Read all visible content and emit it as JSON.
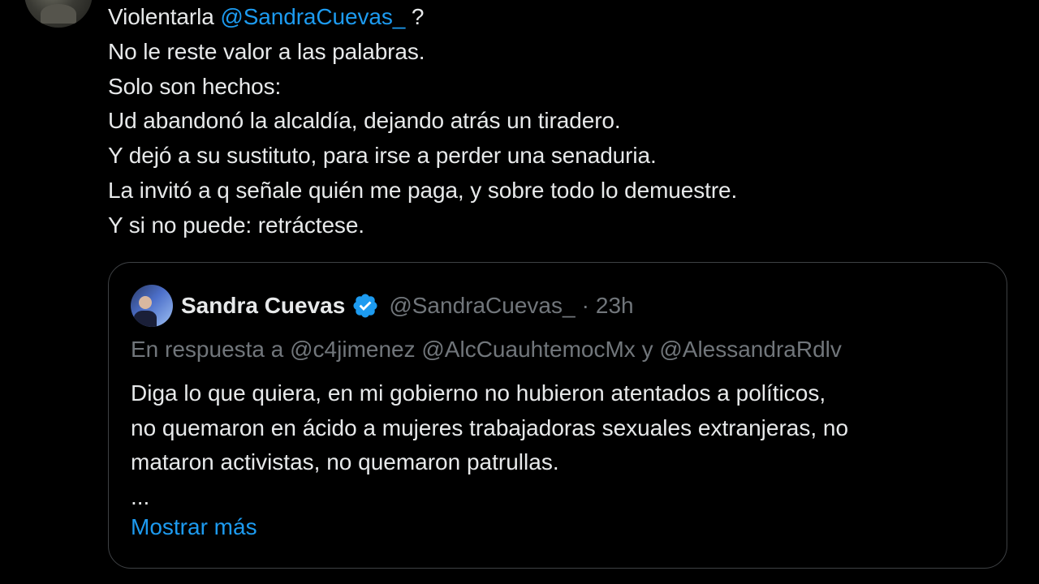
{
  "tweet": {
    "line1_prefix": "Violentarla ",
    "line1_mention": "@SandraCuevas_",
    "line1_suffix": " ?",
    "lines": [
      "No le reste valor a las palabras.",
      "Solo son hechos:",
      "Ud abandonó la alcaldía, dejando atrás un tiradero.",
      "Y dejó a su sustituto, para irse a perder una senaduria.",
      "La invitó a q señale quién me paga, y sobre todo lo demuestre.",
      "Y si no puede: retráctese."
    ]
  },
  "quote": {
    "name": "Sandra Cuevas",
    "handle": "@SandraCuevas_",
    "separator": "·",
    "time": "23h",
    "reply_prefix": "En respuesta a ",
    "reply_mentions": "@c4jimenez @AlcCuauhtemocMx y @AlessandraRdlv",
    "text_lines": [
      "Diga lo que quiera, en mi gobierno no hubieron atentados a políticos,",
      "no quemaron en ácido a mujeres trabajadoras sexuales extranjeras, no",
      "mataron activistas, no quemaron patrullas.",
      "..."
    ],
    "show_more": "Mostrar más"
  },
  "icons": {
    "verified": "verified-badge-icon"
  },
  "colors": {
    "background": "#000000",
    "text": "#e7e9ea",
    "muted": "#71767b",
    "accent": "#1d9bf0",
    "border": "#3e4144"
  }
}
